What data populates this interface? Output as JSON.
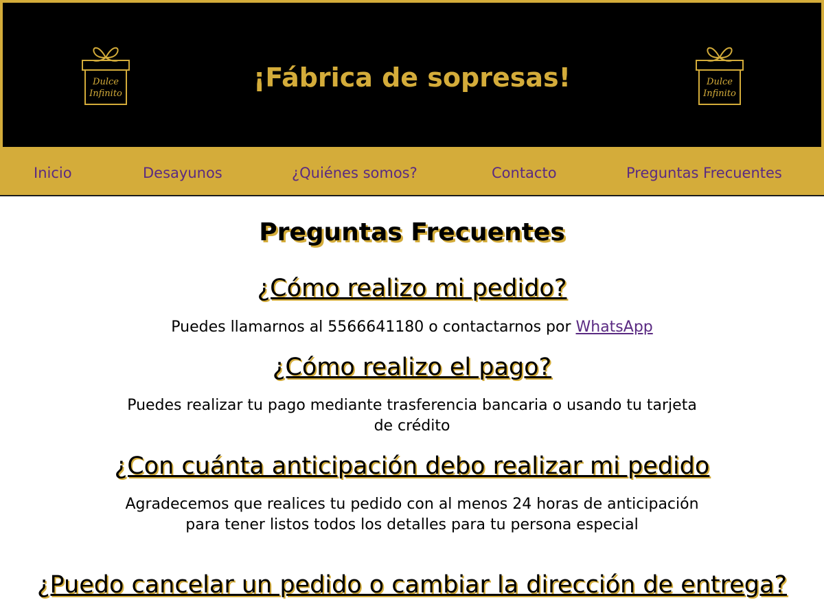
{
  "header": {
    "title": "¡Fábrica de sopresas!",
    "logo_text": [
      "Dulce",
      "Infinito"
    ],
    "colors": {
      "gold": "#d4ac3a",
      "black": "#000000",
      "purple": "#5a2a82"
    }
  },
  "nav": {
    "items": [
      {
        "label": "Inicio"
      },
      {
        "label": "Desayunos"
      },
      {
        "label": "¿Quiénes somos?"
      },
      {
        "label": "Contacto"
      },
      {
        "label": "Preguntas Frecuentes"
      }
    ]
  },
  "faq": {
    "title": "Preguntas Frecuentes",
    "items": [
      {
        "question": "¿Cómo realizo mi pedido?",
        "answer_prefix": "Puedes llamarnos al 5566641180 o contactarnos por ",
        "answer_link": "WhatsApp"
      },
      {
        "question": "¿Cómo realizo el pago?",
        "answer": "Puedes realizar tu pago mediante trasferencia bancaria o usando tu tarjeta de crédito"
      },
      {
        "question": "¿Con cuánta anticipación debo realizar mi pedido",
        "answer": "Agradecemos que realices tu pedido con al menos 24 horas de anticipación para tener listos todos los detalles para tu persona especial"
      },
      {
        "question": "¿Puedo cancelar un pedido o cambiar la dirección de entrega?"
      }
    ]
  }
}
